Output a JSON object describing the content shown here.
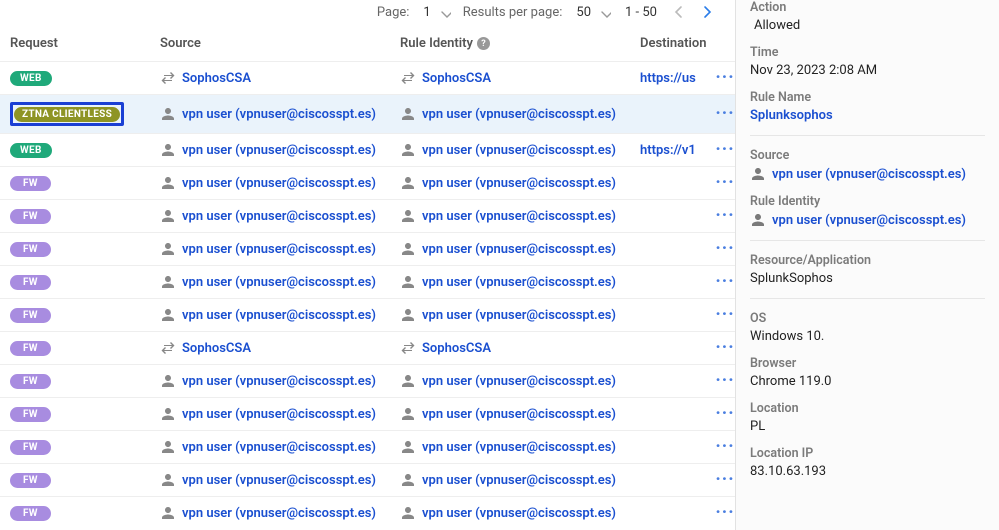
{
  "pagination": {
    "page_label": "Page:",
    "page_value": "1",
    "results_label": "Results per page:",
    "results_value": "50",
    "range": "1 - 50"
  },
  "columns": {
    "request": "Request",
    "source": "Source",
    "rule": "Rule Identity",
    "destination": "Destination"
  },
  "badges": {
    "web": "WEB",
    "ztna": "ZTNA CLIENTLESS",
    "fw": "FW"
  },
  "users": {
    "vpn": "vpn user (vpnuser@ciscosspt.es)",
    "sophos": "SophosCSA"
  },
  "destinations": {
    "d1": "https://us",
    "d2": "https://v1"
  },
  "rows": [
    {
      "badge": "web",
      "source": "sophos",
      "rule": "sophos",
      "dest": "d1",
      "icon": "swap"
    },
    {
      "badge": "ztna",
      "source": "vpn",
      "rule": "vpn",
      "dest": "",
      "icon": "user",
      "highlight": true
    },
    {
      "badge": "web",
      "source": "vpn",
      "rule": "vpn",
      "dest": "d2",
      "icon": "user"
    },
    {
      "badge": "fw",
      "source": "vpn",
      "rule": "vpn",
      "dest": "",
      "icon": "user"
    },
    {
      "badge": "fw",
      "source": "vpn",
      "rule": "vpn",
      "dest": "",
      "icon": "user"
    },
    {
      "badge": "fw",
      "source": "vpn",
      "rule": "vpn",
      "dest": "",
      "icon": "user"
    },
    {
      "badge": "fw",
      "source": "vpn",
      "rule": "vpn",
      "dest": "",
      "icon": "user"
    },
    {
      "badge": "fw",
      "source": "vpn",
      "rule": "vpn",
      "dest": "",
      "icon": "user"
    },
    {
      "badge": "fw",
      "source": "sophos",
      "rule": "sophos",
      "dest": "",
      "icon": "swap"
    },
    {
      "badge": "fw",
      "source": "vpn",
      "rule": "vpn",
      "dest": "",
      "icon": "user"
    },
    {
      "badge": "fw",
      "source": "vpn",
      "rule": "vpn",
      "dest": "",
      "icon": "user"
    },
    {
      "badge": "fw",
      "source": "vpn",
      "rule": "vpn",
      "dest": "",
      "icon": "user"
    },
    {
      "badge": "fw",
      "source": "vpn",
      "rule": "vpn",
      "dest": "",
      "icon": "user"
    },
    {
      "badge": "fw",
      "source": "vpn",
      "rule": "vpn",
      "dest": "",
      "icon": "user"
    }
  ],
  "details": {
    "action_label": "Action",
    "action_value": "Allowed",
    "time_label": "Time",
    "time_value": "Nov 23, 2023 2:08 AM",
    "rulename_label": "Rule Name",
    "rulename_value": "Splunksophos",
    "source_label": "Source",
    "source_value": "vpn user (vpnuser@ciscosspt.es)",
    "ruleid_label": "Rule Identity",
    "ruleid_value": "vpn user (vpnuser@ciscosspt.es)",
    "resource_label": "Resource/Application",
    "resource_value": "SplunkSophos",
    "os_label": "OS",
    "os_value": "Windows 10.",
    "browser_label": "Browser",
    "browser_value": "Chrome 119.0",
    "location_label": "Location",
    "location_value": "PL",
    "locip_label": "Location IP",
    "locip_value": "83.10.63.193"
  }
}
